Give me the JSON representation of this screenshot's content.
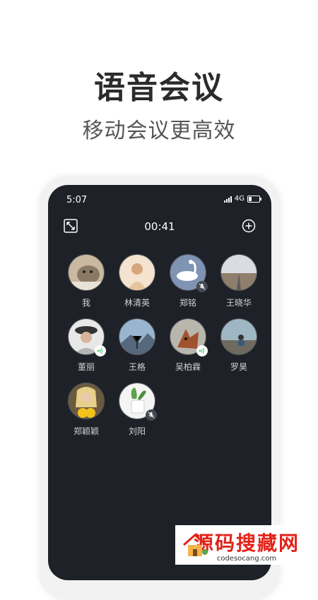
{
  "promo": {
    "title": "语音会议",
    "subtitle": "移动会议更高效"
  },
  "status_bar": {
    "time": "5:07",
    "network": "4G"
  },
  "meeting": {
    "timer": "00:41"
  },
  "participants": [
    {
      "name": "我",
      "state": "none"
    },
    {
      "name": "林清英",
      "state": "none"
    },
    {
      "name": "郑铭",
      "state": "muted"
    },
    {
      "name": "王晓华",
      "state": "none"
    },
    {
      "name": "董丽",
      "state": "speaking"
    },
    {
      "name": "王格",
      "state": "none"
    },
    {
      "name": "吴柏霖",
      "state": "speaking"
    },
    {
      "name": "罗昊",
      "state": "none"
    },
    {
      "name": "郑颖颖",
      "state": "none"
    },
    {
      "name": "刘阳",
      "state": "muted"
    }
  ],
  "icons": {
    "collapse": "collapse-screen-icon",
    "add": "add-circle-icon",
    "speaking": "speaker-wave-icon",
    "muted": "mic-muted-icon"
  },
  "watermark": {
    "title": "源码搜藏网",
    "url": "codesocang.com"
  },
  "colors": {
    "screen_bg": "#1e2127",
    "speaking_accent": "#3fc35f"
  }
}
